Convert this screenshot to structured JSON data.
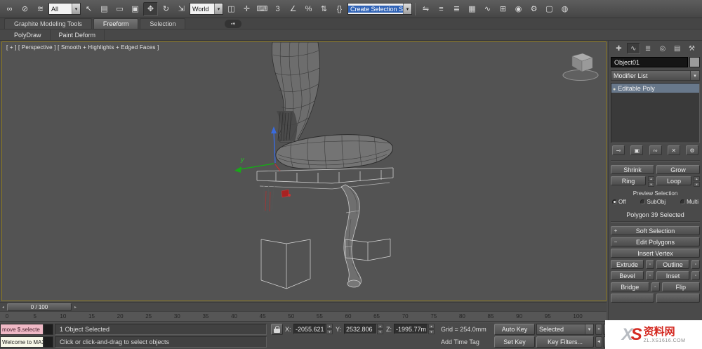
{
  "toolbar": {
    "group1": [
      {
        "name": "select-and-link-icon",
        "glyph": "∞"
      },
      {
        "name": "unlink-selection-icon",
        "glyph": "⊘"
      },
      {
        "name": "bind-to-space-warp-icon",
        "glyph": "≋"
      }
    ],
    "filter_dropdown": "All",
    "group2": [
      {
        "name": "select-object-icon",
        "glyph": "↖"
      },
      {
        "name": "select-by-name-icon",
        "glyph": "▤"
      },
      {
        "name": "rectangular-selection-region-icon",
        "glyph": "▭"
      },
      {
        "name": "window-crossing-icon",
        "glyph": "▣"
      },
      {
        "name": "select-and-move-icon",
        "glyph": "✥",
        "active": true
      },
      {
        "name": "select-and-rotate-icon",
        "glyph": "↻"
      },
      {
        "name": "select-and-scale-icon",
        "glyph": "⇲"
      }
    ],
    "coord_dropdown": "World",
    "group3": [
      {
        "name": "use-pivot-point-center-icon",
        "glyph": "◫"
      },
      {
        "name": "select-and-manipulate-icon",
        "glyph": "✛"
      },
      {
        "name": "keyboard-shortcut-override-icon",
        "glyph": "⌨"
      },
      {
        "name": "snaps-toggle-icon",
        "glyph": "3"
      },
      {
        "name": "angle-snap-icon",
        "glyph": "∠"
      },
      {
        "name": "percent-snap-icon",
        "glyph": "%"
      },
      {
        "name": "spinner-snap-icon",
        "glyph": "⇅"
      },
      {
        "name": "named-selection-sets-icon",
        "glyph": "{}"
      }
    ],
    "selection_set_dropdown": "Create Selection Se",
    "group4": [
      {
        "name": "mirror-icon",
        "glyph": "⇋"
      },
      {
        "name": "align-icon",
        "glyph": "≡"
      },
      {
        "name": "layer-manager-icon",
        "glyph": "≣"
      },
      {
        "name": "graphite-ribbon-toggle-icon",
        "glyph": "▦"
      },
      {
        "name": "curve-editor-icon",
        "glyph": "∿"
      },
      {
        "name": "schematic-view-icon",
        "glyph": "⊞"
      },
      {
        "name": "material-editor-icon",
        "glyph": "◉"
      },
      {
        "name": "render-setup-icon",
        "glyph": "⚙"
      },
      {
        "name": "rendered-frame-window-icon",
        "glyph": "▢"
      },
      {
        "name": "render-production-icon",
        "glyph": "◍"
      }
    ]
  },
  "ribbon": {
    "tabs": [
      {
        "label": "Graphite Modeling Tools"
      },
      {
        "label": "Freeform",
        "active": true
      },
      {
        "label": "Selection"
      }
    ],
    "minimize_glyph": "▪▾",
    "subtabs": [
      {
        "label": "PolyDraw"
      },
      {
        "label": "Paint Deform"
      }
    ]
  },
  "viewport": {
    "label": "[ + ] [ Perspective ] [ Smooth + Highlights + Edged Faces ]",
    "gizmo_y_label": "y"
  },
  "command_panel": {
    "tabs": [
      {
        "name": "create-tab-icon",
        "glyph": "✚"
      },
      {
        "name": "modify-tab-icon",
        "glyph": "∿",
        "active": true
      },
      {
        "name": "hierarchy-tab-icon",
        "glyph": "≣"
      },
      {
        "name": "motion-tab-icon",
        "glyph": "◎"
      },
      {
        "name": "display-tab-icon",
        "glyph": "▤"
      },
      {
        "name": "utilities-tab-icon",
        "glyph": "⚒"
      }
    ],
    "object_name": "Object01",
    "modifier_list_label": "Modifier List",
    "stack_items": [
      {
        "label": "Editable Poly",
        "selected": true
      }
    ],
    "stack_tools": [
      {
        "name": "pin-stack-icon",
        "glyph": "⊸"
      },
      {
        "name": "show-end-result-icon",
        "glyph": "▣"
      },
      {
        "name": "make-unique-icon",
        "glyph": "∾"
      },
      {
        "name": "remove-modifier-icon",
        "glyph": "✕"
      },
      {
        "name": "configure-modifier-sets-icon",
        "glyph": "⚙"
      }
    ],
    "selection_tools": {
      "shrink": "Shrink",
      "grow": "Grow",
      "ring": "Ring",
      "loop": "Loop"
    },
    "preview_selection": {
      "title": "Preview Selection",
      "options": [
        {
          "label": "Off",
          "selected": true
        },
        {
          "label": "SubObj"
        },
        {
          "label": "Multi"
        }
      ]
    },
    "selection_status": "Polygon 39 Selected",
    "rollouts": {
      "soft_selection": "Soft Selection",
      "soft_selection_toggle": "+",
      "edit_polygons": "Edit Polygons",
      "edit_polygons_toggle": "−"
    },
    "edit_buttons": {
      "insert_vertex": "Insert Vertex",
      "extrude": "Extrude",
      "outline": "Outline",
      "bevel": "Bevel",
      "inset": "Inset",
      "bridge": "Bridge",
      "flip": "Flip"
    }
  },
  "timeline": {
    "slider_label": "0 / 100",
    "ticks": [
      "0",
      "5",
      "10",
      "15",
      "20",
      "25",
      "30",
      "35",
      "40",
      "45",
      "50",
      "55",
      "60",
      "65",
      "70",
      "75",
      "80",
      "85",
      "90",
      "95",
      "100"
    ]
  },
  "status_bar": {
    "listener_line1": "move $.selecte",
    "listener_line2": "Welcome to MAX!",
    "selection_status": "1 Object Selected",
    "prompt": "Click or click-and-drag to select objects",
    "x_label": "X:",
    "x_value": "-2055.621",
    "y_label": "Y:",
    "y_value": "2532.806",
    "z_label": "Z:",
    "z_value": "-1995.77m",
    "grid_label": "Grid = 254.0mm",
    "add_time_tag": "Add Time Tag",
    "auto_key": "Auto Key",
    "set_key": "Set Key",
    "key_mode": "Selected",
    "key_filters": "Key Filters...",
    "nav": [
      {
        "name": "go-to-start-icon",
        "glyph": "«"
      },
      {
        "name": "go-to-end-icon",
        "glyph": "»"
      },
      {
        "name": "previous-frame-icon",
        "glyph": "◄"
      },
      {
        "name": "play-animation-icon",
        "glyph": "►"
      }
    ]
  },
  "watermark": {
    "logo_x": "X",
    "logo_s": "S",
    "site_name": "资料网",
    "site_url": "ZL.XS1616.COM"
  }
}
